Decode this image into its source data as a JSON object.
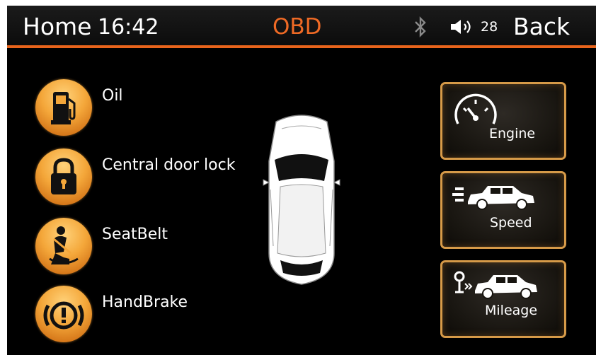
{
  "header": {
    "home_label": "Home",
    "time": "16:42",
    "title": "OBD",
    "volume": "28",
    "back_label": "Back"
  },
  "status_items": [
    {
      "label": "Oil",
      "icon": "fuel-pump-icon"
    },
    {
      "label": "Central door lock",
      "icon": "padlock-icon"
    },
    {
      "label": "SeatBelt",
      "icon": "seatbelt-icon"
    },
    {
      "label": "HandBrake",
      "icon": "handbrake-warning-icon"
    }
  ],
  "functions": [
    {
      "label": "Engine",
      "icon": "speedometer-icon"
    },
    {
      "label": "Speed",
      "icon": "moving-car-icon"
    },
    {
      "label": "Mileage",
      "icon": "mileage-car-icon"
    }
  ],
  "colors": {
    "accent": "#e8641c",
    "title": "#ef6a25",
    "button_border": "#d69a48",
    "orb": "#f4a73a",
    "background": "#000000"
  }
}
